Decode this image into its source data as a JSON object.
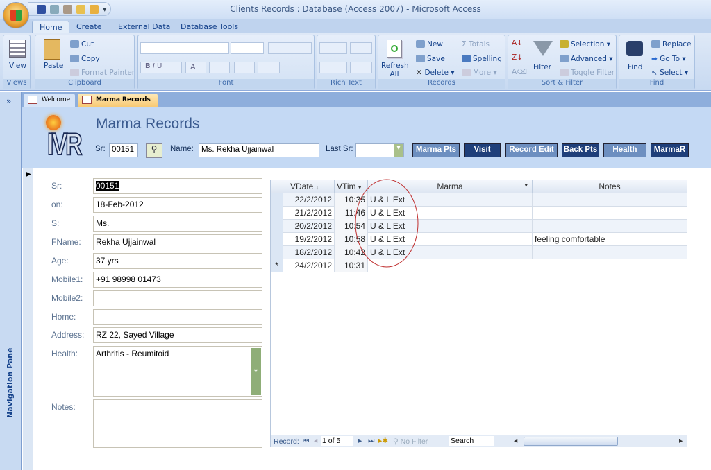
{
  "app": {
    "title": "Clients Records : Database (Access 2007) - Microsoft Access"
  },
  "ribbon": {
    "tabs": [
      "Home",
      "Create",
      "External Data",
      "Database Tools"
    ],
    "groups": {
      "views": "Views",
      "clipboard": "Clipboard",
      "font": "Font",
      "rich_text": "Rich Text",
      "records": "Records",
      "sort_filter": "Sort & Filter",
      "find": "Find"
    },
    "view": "View",
    "paste": "Paste",
    "cut": "Cut",
    "copy": "Copy",
    "format_painter": "Format Painter",
    "refresh": "Refresh All",
    "new": "New",
    "save": "Save",
    "delete": "Delete",
    "totals": "Totals",
    "spelling": "Spelling",
    "more": "More",
    "filter": "Filter",
    "selection": "Selection",
    "advanced": "Advanced",
    "toggle_filter": "Toggle Filter",
    "find": "Find",
    "replace": "Replace",
    "goto": "Go To",
    "select": "Select",
    "font_buttons": [
      "B",
      "I",
      "U",
      "A"
    ]
  },
  "nav_pane": {
    "label": "Navigation Pane",
    "toggle": "»"
  },
  "doc_tabs": [
    "Welcome",
    "Marma Records"
  ],
  "header": {
    "title": "Marma Records",
    "logo": "IVR",
    "sr_label": "Sr:",
    "sr_value": "00151",
    "name_label": "Name:",
    "name_value": "Ms. Rekha Ujjainwal",
    "last_sr_label": "Last Sr:",
    "last_sr_value": "",
    "buttons": [
      {
        "label": "Marma Pts",
        "color": "#6d8fc0"
      },
      {
        "label": "Visit",
        "color": "#1f3f7a"
      },
      {
        "label": "Record Edit",
        "color": "#6d8fc0"
      },
      {
        "label": "Back Pts",
        "color": "#1f3f7a"
      },
      {
        "label": "Health",
        "color": "#6d8fc0"
      },
      {
        "label": "MarmaR",
        "color": "#1f3f7a"
      }
    ]
  },
  "form": {
    "fields": [
      {
        "label": "Sr:",
        "value": "00151"
      },
      {
        "label": "on:",
        "value": "18-Feb-2012"
      },
      {
        "label": "S:",
        "value": "Ms."
      },
      {
        "label": "FName:",
        "value": "Rekha Ujjainwal"
      },
      {
        "label": "Age:",
        "value": "37 yrs"
      },
      {
        "label": "Mobile1:",
        "value": "+91 98998 01473"
      },
      {
        "label": "Mobile2:",
        "value": ""
      },
      {
        "label": "Home:",
        "value": ""
      },
      {
        "label": "Address:",
        "value": "RZ 22, Sayed Village"
      },
      {
        "label": "Health:",
        "value": "Arthritis - Reumitoid"
      },
      {
        "label": "Notes:",
        "value": ""
      }
    ]
  },
  "datasheet": {
    "columns": [
      "VDate",
      "VTim",
      "Marma",
      "Notes"
    ],
    "rows": [
      [
        "22/2/2012",
        "10:35",
        "U & L Ext",
        ""
      ],
      [
        "21/2/2012",
        "11:46",
        "U & L Ext",
        ""
      ],
      [
        "20/2/2012",
        "10:54",
        "U & L Ext",
        ""
      ],
      [
        "19/2/2012",
        "10:58",
        "U & L Ext",
        "feeling comfortable"
      ],
      [
        "18/2/2012",
        "10:42",
        "U & L Ext",
        ""
      ]
    ],
    "new_row": {
      "marker": "*",
      "date": "24/2/2012",
      "time": "10:31"
    },
    "nav": {
      "record_label": "Record:",
      "position": "1 of 5",
      "no_filter": "No Filter",
      "search": "Search"
    }
  },
  "annotation": {
    "color": "#c03030"
  }
}
